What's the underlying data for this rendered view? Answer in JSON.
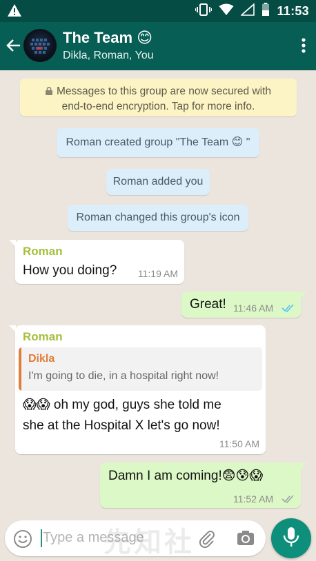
{
  "status_bar": {
    "time": "11:53",
    "icons": [
      "warning-icon",
      "vibrate-icon",
      "wifi-icon",
      "signal-icon",
      "battery-icon"
    ]
  },
  "header": {
    "title": "The Team 😊",
    "subtitle": "Dikla, Roman, You",
    "icons": [
      "back-arrow-icon",
      "group-avatar",
      "more-vert-icon"
    ]
  },
  "chat": {
    "encryption_notice_line1": "Messages to this group are now secured with",
    "encryption_notice_line2": "end-to-end encryption. Tap for more info.",
    "system_messages": [
      "Roman created group \"The Team 😊 \"",
      "Roman added you",
      "Roman changed this group's icon"
    ],
    "messages": [
      {
        "direction": "incoming",
        "sender": "Roman",
        "text": "How you doing?",
        "time": "11:19 AM"
      },
      {
        "direction": "outgoing",
        "text": "Great!",
        "time": "11:46 AM",
        "status": "read"
      },
      {
        "direction": "incoming",
        "sender": "Roman",
        "quoted_sender": "Dikla",
        "quoted_text": "I'm going to die, in a hospital right now!",
        "text_line1": "😱😱 oh my god, guys she told me",
        "text_line2": "she at the Hospital X let's go now!",
        "time": "11:50 AM"
      },
      {
        "direction": "outgoing",
        "text": "Damn I am coming!😨😰😱",
        "time": "11:52 AM",
        "status": "sent"
      }
    ]
  },
  "composer": {
    "placeholder": "Type a message",
    "watermark": "先知社"
  },
  "colors": {
    "status_bar": "#054d44",
    "app_bar": "#075e54",
    "chat_background": "#ece5dd",
    "outgoing_bubble": "#dcf8c6",
    "incoming_bubble": "#ffffff",
    "system_bubble": "#dbeefa",
    "encryption_bubble": "#fcf4c4",
    "sender_name": "#a4bf3c",
    "quote_accent": "#e07e3a",
    "read_ticks": "#4fc3f7",
    "mic_button": "#0d8f7c"
  }
}
